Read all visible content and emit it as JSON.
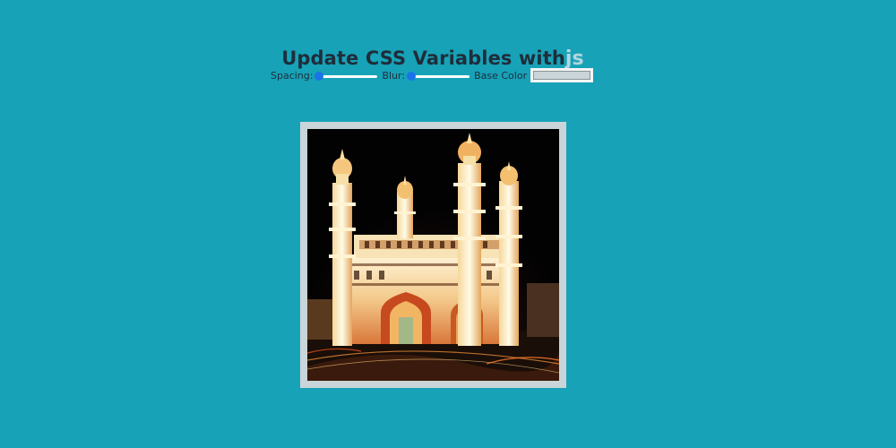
{
  "title": {
    "text": "Update CSS Variables with",
    "highlight": "js"
  },
  "controls": {
    "spacing_label": "Spacing:",
    "spacing_value": 0,
    "blur_label": "Blur:",
    "blur_value": 0,
    "base_color_label": "Base Color",
    "base_color_value": "#c9d5d8"
  },
  "image": {
    "subject": "Charminar monument illuminated at night"
  },
  "colors": {
    "background": "#17a2b8",
    "heading": "#1f2d3a",
    "highlight": "#b5d6df",
    "slider_thumb": "#1a73e8"
  }
}
